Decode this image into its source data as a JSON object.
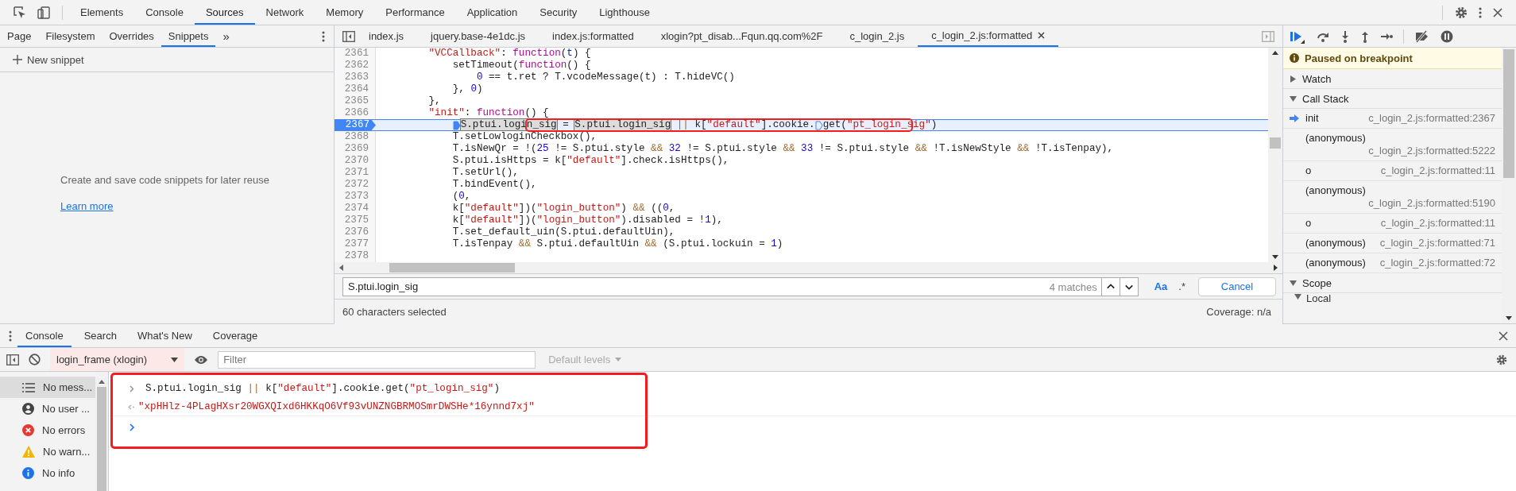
{
  "toolbar": {
    "tabs": [
      {
        "label": "Elements",
        "selected": false
      },
      {
        "label": "Console",
        "selected": false
      },
      {
        "label": "Sources",
        "selected": true
      },
      {
        "label": "Network",
        "selected": false
      },
      {
        "label": "Memory",
        "selected": false
      },
      {
        "label": "Performance",
        "selected": false
      },
      {
        "label": "Application",
        "selected": false
      },
      {
        "label": "Security",
        "selected": false
      },
      {
        "label": "Lighthouse",
        "selected": false
      }
    ]
  },
  "sources": {
    "navigator": {
      "tabs": [
        {
          "label": "Page",
          "selected": false
        },
        {
          "label": "Filesystem",
          "selected": false
        },
        {
          "label": "Overrides",
          "selected": false
        },
        {
          "label": "Snippets",
          "selected": true
        }
      ],
      "more": "»",
      "new_snippet": "New snippet",
      "empty_message": "Create and save code snippets for later reuse",
      "link": "Learn more"
    },
    "editor": {
      "tabs": [
        {
          "label": "index.js",
          "selected": false,
          "closable": false
        },
        {
          "label": "jquery.base-4e1dc.js",
          "selected": false,
          "closable": false
        },
        {
          "label": "index.js:formatted",
          "selected": false,
          "closable": false
        },
        {
          "label": "xlogin?pt_disab...Fqun.qq.com%2F",
          "selected": false,
          "closable": false
        },
        {
          "label": "c_login_2.js",
          "selected": false,
          "closable": false
        },
        {
          "label": "c_login_2.js:formatted",
          "selected": true,
          "closable": true
        }
      ],
      "lines": [
        {
          "number": "2361",
          "selected": false,
          "tokens": [
            {
              "kind": "string",
              "text": "        \"VCCallback\""
            },
            {
              "kind": "plain",
              "text": ": "
            },
            {
              "kind": "keyword",
              "text": "function"
            },
            {
              "kind": "plain",
              "text": "("
            },
            {
              "kind": "param",
              "text": "t"
            },
            {
              "kind": "plain",
              "text": ") {"
            }
          ]
        },
        {
          "number": "2362",
          "selected": false,
          "tokens": [
            {
              "kind": "plain",
              "text": "            setTimeout("
            },
            {
              "kind": "keyword",
              "text": "function"
            },
            {
              "kind": "plain",
              "text": "() {"
            }
          ]
        },
        {
          "number": "2363",
          "selected": false,
          "tokens": [
            {
              "kind": "number",
              "text": "                0"
            },
            {
              "kind": "plain",
              "text": " == t.ret ? T.vcodeMessage(t) : T.hideVC()"
            }
          ]
        },
        {
          "number": "2364",
          "selected": false,
          "tokens": [
            {
              "kind": "plain",
              "text": "            }, "
            },
            {
              "kind": "number",
              "text": "0"
            },
            {
              "kind": "plain",
              "text": ")"
            }
          ]
        },
        {
          "number": "2365",
          "selected": false,
          "tokens": [
            {
              "kind": "plain",
              "text": "        },"
            }
          ]
        },
        {
          "number": "2366",
          "selected": false,
          "tokens": [
            {
              "kind": "string",
              "text": "        \"init\""
            },
            {
              "kind": "plain",
              "text": ": "
            },
            {
              "kind": "keyword",
              "text": "function"
            },
            {
              "kind": "plain",
              "text": "() {"
            }
          ]
        },
        {
          "number": "2367",
          "selected": true,
          "tokens": [
            {
              "kind": "breakpoint",
              "active": true
            },
            {
              "kind": "match",
              "text": "S.ptui.login_sig"
            },
            {
              "kind": "plain",
              "text": " = "
            },
            {
              "kind": "match",
              "text": "S.ptui.login_sig"
            },
            {
              "kind": "operator",
              "text": " ||"
            },
            {
              "kind": "plain",
              "text": " k["
            },
            {
              "kind": "string",
              "text": "\"default\""
            },
            {
              "kind": "plain",
              "text": "].cookie."
            },
            {
              "kind": "breakpoint",
              "active": false
            },
            {
              "kind": "plain",
              "text": "get("
            },
            {
              "kind": "string",
              "text": "\"pt_login_sig\""
            },
            {
              "kind": "plain",
              "text": ")"
            }
          ]
        },
        {
          "number": "2368",
          "selected": false,
          "tokens": [
            {
              "kind": "plain",
              "text": "            T.setLowloginCheckbox(),"
            }
          ]
        },
        {
          "number": "2369",
          "selected": false,
          "tokens": [
            {
              "kind": "plain",
              "text": "            T.isNewQr = !("
            },
            {
              "kind": "number",
              "text": "25"
            },
            {
              "kind": "plain",
              "text": " != S.ptui.style "
            },
            {
              "kind": "operator",
              "text": "&&"
            },
            {
              "kind": "number",
              "text": " 32"
            },
            {
              "kind": "plain",
              "text": " != S.ptui.style "
            },
            {
              "kind": "operator",
              "text": "&&"
            },
            {
              "kind": "number",
              "text": " 33"
            },
            {
              "kind": "plain",
              "text": " != S.ptui.style "
            },
            {
              "kind": "operator",
              "text": "&&"
            },
            {
              "kind": "plain",
              "text": " !T.isNewStyle "
            },
            {
              "kind": "operator",
              "text": "&&"
            },
            {
              "kind": "plain",
              "text": " !T.isTenpay),"
            }
          ]
        },
        {
          "number": "2370",
          "selected": false,
          "tokens": [
            {
              "kind": "plain",
              "text": "            S.ptui.isHttps = k["
            },
            {
              "kind": "string",
              "text": "\"default\""
            },
            {
              "kind": "plain",
              "text": "].check.isHttps(),"
            }
          ]
        },
        {
          "number": "2371",
          "selected": false,
          "tokens": [
            {
              "kind": "plain",
              "text": "            T.setUrl(),"
            }
          ]
        },
        {
          "number": "2372",
          "selected": false,
          "tokens": [
            {
              "kind": "plain",
              "text": "            T.bindEvent(),"
            }
          ]
        },
        {
          "number": "2373",
          "selected": false,
          "tokens": [
            {
              "kind": "plain",
              "text": "            ("
            },
            {
              "kind": "number",
              "text": "0"
            },
            {
              "kind": "plain",
              "text": ","
            }
          ]
        },
        {
          "number": "2374",
          "selected": false,
          "tokens": [
            {
              "kind": "plain",
              "text": "            k["
            },
            {
              "kind": "string",
              "text": "\"default\""
            },
            {
              "kind": "plain",
              "text": "])("
            },
            {
              "kind": "string",
              "text": "\"login_button\""
            },
            {
              "kind": "plain",
              "text": ") "
            },
            {
              "kind": "operator",
              "text": "&&"
            },
            {
              "kind": "plain",
              "text": " (("
            },
            {
              "kind": "number",
              "text": "0"
            },
            {
              "kind": "plain",
              "text": ","
            }
          ]
        },
        {
          "number": "2375",
          "selected": false,
          "tokens": [
            {
              "kind": "plain",
              "text": "            k["
            },
            {
              "kind": "string",
              "text": "\"default\""
            },
            {
              "kind": "plain",
              "text": "])("
            },
            {
              "kind": "string",
              "text": "\"login_button\""
            },
            {
              "kind": "plain",
              "text": ").disabled = !"
            },
            {
              "kind": "number",
              "text": "1"
            },
            {
              "kind": "plain",
              "text": "),"
            }
          ]
        },
        {
          "number": "2376",
          "selected": false,
          "tokens": [
            {
              "kind": "plain",
              "text": "            T.set_default_uin(S.ptui.defaultUin),"
            }
          ]
        },
        {
          "number": "2377",
          "selected": false,
          "tokens": [
            {
              "kind": "plain",
              "text": "            T.isTenpay "
            },
            {
              "kind": "operator",
              "text": "&&"
            },
            {
              "kind": "plain",
              "text": " S.ptui.defaultUin "
            },
            {
              "kind": "operator",
              "text": "&&"
            },
            {
              "kind": "plain",
              "text": " (S.ptui.lockuin = "
            },
            {
              "kind": "number",
              "text": "1"
            },
            {
              "kind": "plain",
              "text": ")"
            }
          ]
        },
        {
          "number": "2378",
          "selected": false
        }
      ],
      "search": {
        "value": "S.ptui.login_sig",
        "matches": "4 matches",
        "case_label": "Aa",
        "regex_label": ".*",
        "cancel": "Cancel"
      },
      "status": {
        "selection": "60 characters selected",
        "coverage": "Coverage: n/a"
      }
    }
  },
  "debugger": {
    "banner": "Paused on breakpoint",
    "sections": [
      {
        "title": "Watch",
        "expanded": false
      },
      {
        "title": "Call Stack",
        "expanded": true,
        "frames": [
          {
            "name": "init",
            "location": "c_login_2.js:formatted:2367",
            "selected": true
          },
          {
            "name": "(anonymous)",
            "location": "c_login_2.js:formatted:5222",
            "selected": false
          },
          {
            "name": "o",
            "location": "c_login_2.js:formatted:11",
            "selected": false
          },
          {
            "name": "(anonymous)",
            "location": "c_login_2.js:formatted:5190",
            "selected": false
          },
          {
            "name": "o",
            "location": "c_login_2.js:formatted:11",
            "selected": false
          },
          {
            "name": "(anonymous)",
            "location": "c_login_2.js:formatted:71",
            "selected": false
          },
          {
            "name": "(anonymous)",
            "location": "c_login_2.js:formatted:72",
            "selected": false
          }
        ]
      },
      {
        "title": "Scope",
        "expanded": true,
        "children": [
          {
            "title": "Local"
          }
        ]
      }
    ]
  },
  "drawer": {
    "tabs": [
      {
        "label": "Console",
        "selected": true
      },
      {
        "label": "Search",
        "selected": false
      },
      {
        "label": "What's New",
        "selected": false
      },
      {
        "label": "Coverage",
        "selected": false
      }
    ],
    "context": "login_frame (xlogin)",
    "filter": {
      "placeholder": "Filter"
    },
    "levels": {
      "label": "Default levels",
      "disabled": true
    },
    "sidebar": [
      {
        "kind": "messages",
        "label": "No mess...",
        "selected": true
      },
      {
        "kind": "user",
        "label": "No user ...",
        "selected": false
      },
      {
        "kind": "errors",
        "label": "No errors",
        "selected": false
      },
      {
        "kind": "warnings",
        "label": "No warn...",
        "selected": false
      },
      {
        "kind": "info",
        "label": "No info",
        "selected": false
      }
    ],
    "console": [
      {
        "kind": "input",
        "tokens": [
          {
            "kind": "plain",
            "text": "S.ptui.login_sig "
          },
          {
            "kind": "operator",
            "text": "||"
          },
          {
            "kind": "plain",
            "text": " k["
          },
          {
            "kind": "string",
            "text": "\"default\""
          },
          {
            "kind": "plain",
            "text": "].cookie.get("
          },
          {
            "kind": "string",
            "text": "\"pt_login_sig\""
          },
          {
            "kind": "plain",
            "text": ")"
          }
        ]
      },
      {
        "kind": "result",
        "text": "\"xpHHlz-4PLagHXsr20WGXQIxd6HKKqO6Vf93vUNZNGBRMOSmrDWSHe*16ynnd7xj\""
      },
      {
        "kind": "prompt"
      }
    ]
  }
}
